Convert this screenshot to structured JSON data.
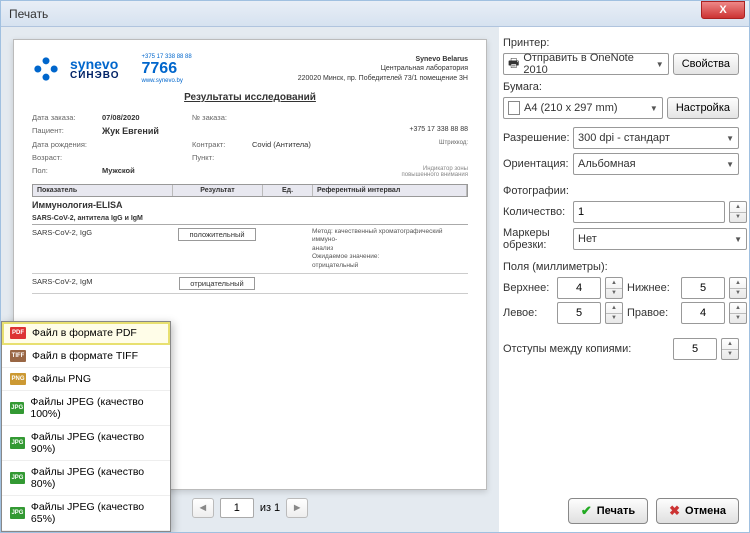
{
  "window_title": "Печать",
  "titlebar_close": "X",
  "preview": {
    "logo_primary": "synevo",
    "logo_secondary": "СИНЭВО",
    "phone_pre": "+375 17 338 88 88",
    "phone_big": "7766",
    "phone_site": "www.synevo.by",
    "org_name": "Synevo Belarus",
    "org_sub": "Центральная лаборатория",
    "org_addr": "220020 Минск, пр. Победителей 73/1 помещение 3Н",
    "fax": "+375 17 338 88 88",
    "doc_title": "Результаты исследований",
    "rows": {
      "order_date_lbl": "Дата заказа:",
      "order_date": "07/08/2020",
      "order_no_lbl": "№ заказа:",
      "patient_lbl": "Пациент:",
      "patient": "Жук Евгений",
      "dob_lbl": "Дата рождения:",
      "contract_lbl": "Контракт:",
      "contract": "Covid (Антитела)",
      "barcode_lbl": "Штрихкод:",
      "age_lbl": "Возраст:",
      "point_lbl": "Пункт:",
      "sex_lbl": "Пол:",
      "sex": "Мужской",
      "indicator_note": "Индикатор зоны\nповышенного внимания"
    },
    "tbl": {
      "h1": "Показатель",
      "h2": "Результат",
      "h3": "Ед.",
      "h4": "Референтный интервал",
      "section": "Иммунология-ELISA",
      "subsection": "SARS-CoV-2, антитела IgG и IgM",
      "r1_name": "SARS-CoV-2, IgG",
      "r1_res": "положительный",
      "r1_note": "Метод: качественный хроматографический иммуно-\nанализ\nОжидаемое значение:\nотрицательный",
      "r2_name": "SARS-CoV-2, IgM",
      "r2_res": "отрицательный"
    }
  },
  "export_menu": {
    "pdf": "Файл в формате PDF",
    "tiff": "Файл в формате TIFF",
    "png": "Файлы PNG",
    "jpeg100": "Файлы JPEG (качество 100%)",
    "jpeg90": "Файлы JPEG (качество 90%)",
    "jpeg80": "Файлы JPEG (качество 80%)",
    "jpeg65": "Файлы JPEG (качество 65%)"
  },
  "pager": {
    "page": "1",
    "of": "из 1"
  },
  "settings": {
    "printer_lbl": "Принтер:",
    "printer_val": "Отправить в OneNote 2010",
    "properties_btn": "Свойства",
    "paper_lbl": "Бумага:",
    "paper_val": "A4 (210 x 297 mm)",
    "setup_btn": "Настройка",
    "resolution_lbl": "Разрешение:",
    "resolution_val": "300 dpi - стандарт",
    "orientation_lbl": "Ориентация:",
    "orientation_val": "Альбомная",
    "photos_lbl": "Фотографии:",
    "count_lbl": "Количество:",
    "count_val": "1",
    "crop_lbl": "Маркеры обрезки:",
    "crop_val": "Нет",
    "margins_lbl": "Поля (миллиметры):",
    "top_lbl": "Верхнее:",
    "top_val": "4",
    "bottom_lbl": "Нижнее:",
    "bottom_val": "5",
    "left_lbl": "Левое:",
    "left_val": "5",
    "right_lbl": "Правое:",
    "right_val": "4",
    "gap_lbl": "Отступы между копиями:",
    "gap_val": "5"
  },
  "buttons": {
    "print": "Печать",
    "cancel": "Отмена"
  }
}
